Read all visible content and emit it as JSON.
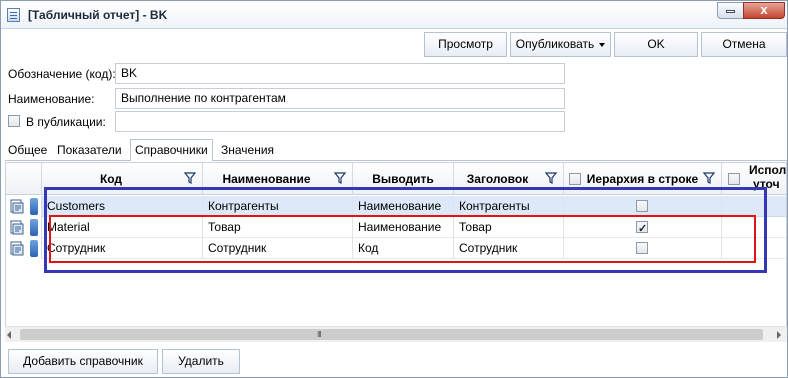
{
  "window": {
    "title": "[Табличный отчет] - BK",
    "close_glyph": "x"
  },
  "toolbar": {
    "preview": "Просмотр",
    "publish": "Опубликовать",
    "ok": "OK",
    "cancel": "Отмена"
  },
  "form": {
    "code_label": "Обозначение (код):",
    "code_value": "BK",
    "name_label": "Наименование:",
    "name_value": "Выполнение по контрагентам",
    "publication_label": "В публикации:",
    "publication_value": ""
  },
  "tabs": [
    "Общее",
    "Показатели",
    "Справочники",
    "Значения"
  ],
  "active_tab": "Справочники",
  "grid": {
    "columns": {
      "code": "Код",
      "name": "Наименование",
      "output": "Выводить",
      "header": "Заголовок",
      "hierarchy": "Иерархия в строке",
      "extra_line1": "Испол",
      "extra_line2": "уточ"
    },
    "rows": [
      {
        "code": "Customers",
        "name": "Контрагенты",
        "output": "Наименование",
        "header": "Контрагенты",
        "hierarchy": false
      },
      {
        "code": "Material",
        "name": "Товар",
        "output": "Наименование",
        "header": "Товар",
        "hierarchy": true
      },
      {
        "code": "Сотрудник",
        "name": "Сотрудник",
        "output": "Код",
        "header": "Сотрудник",
        "hierarchy": false
      }
    ],
    "scroll_grip": "III"
  },
  "buttons": {
    "add": "Добавить справочник",
    "delete": "Удалить"
  },
  "colors": {
    "blue_highlight": "#3437b6",
    "red_highlight": "#e01414",
    "selected_row": "#dde9f8"
  }
}
